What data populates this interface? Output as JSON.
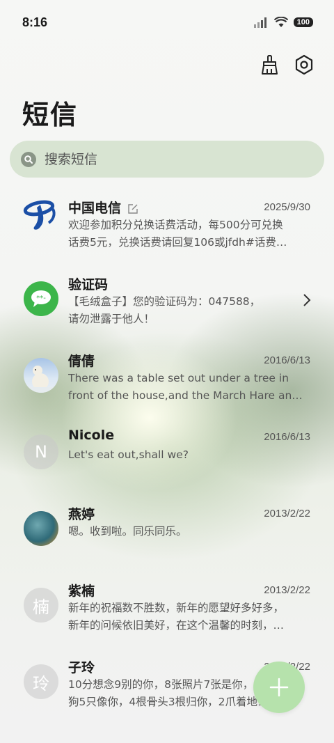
{
  "status": {
    "time": "8:16",
    "battery": "100"
  },
  "header": {
    "title": "短信"
  },
  "search": {
    "placeholder": "搜索短信"
  },
  "messages": [
    {
      "name": "中国电信",
      "date": "2025/9/30",
      "line1": "欢迎参加积分兑换话费活动，每500分可兑换",
      "line2": "话费5元，兑换话费请回复106或jfdh#话费…",
      "avatar": "china-telecom-logo",
      "icon": "edit-note-icon"
    },
    {
      "name": "验证码",
      "date": "",
      "line1": "【毛绒盒子】您的验证码为：047588，",
      "line2": "请勿泄露于他人！",
      "avatar": "message-bubble-icon"
    },
    {
      "name": "倩倩",
      "date": "2016/6/13",
      "line1": "There was a table set out under a tree in",
      "line2": "front of the house,and the March Hare an…",
      "avatar": "polar-bear-photo"
    },
    {
      "name": "Nicole",
      "date": "2016/6/13",
      "line1": "Let's eat out,shall we?",
      "line2": "",
      "avatar_letter": "N"
    },
    {
      "name": "燕婷",
      "date": "2013/2/22",
      "line1": "嗯。收到啦。同乐同乐。",
      "line2": "",
      "avatar": "ocean-photo"
    },
    {
      "name": "紫楠",
      "date": "2013/2/22",
      "line1": "新年的祝福数不胜数，新年的愿望好多好多，",
      "line2": "新年的问候依旧美好，在这个温馨的时刻，…",
      "avatar_letter": "楠"
    },
    {
      "name": "子玲",
      "date": "2013/2/22",
      "line1": "10分想念9别的你，8张照片7张是你，6只小",
      "line2": "狗5只像你，4根骨头3根归你，2爪着地1定…",
      "avatar_letter": "玲"
    }
  ],
  "colors": {
    "fab": "#b6e2ac",
    "search_bg": "#d8e4d2",
    "telecom_blue": "#1b4fa6",
    "verify_green": "#3cb54a"
  }
}
